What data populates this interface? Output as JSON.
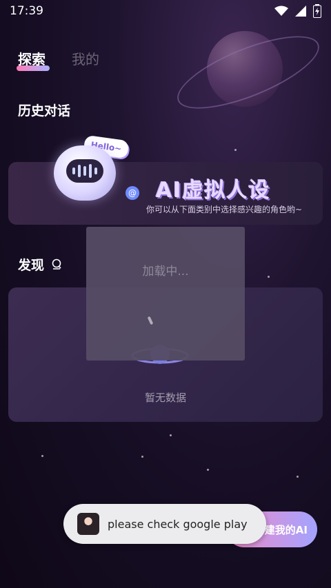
{
  "status_bar": {
    "time": "17:39"
  },
  "tabs": [
    {
      "label": "探索",
      "active": true
    },
    {
      "label": "我的",
      "active": false
    }
  ],
  "history_title": "历史对话",
  "banner": {
    "hello_text": "Hello~",
    "hash_symbol": "#",
    "at_symbol": "@",
    "title": "AI虚拟人设",
    "subtitle": "你可以从下面类别中选择感兴趣的角色哟~"
  },
  "discover": {
    "title": "发现",
    "empty_text": "暂无数据"
  },
  "loading": {
    "text": "加载中..."
  },
  "fab": {
    "label": "建我的AI"
  },
  "toast": {
    "text": "please check google play"
  },
  "colors": {
    "accent_pink": "#f089c7",
    "accent_blue": "#a3a3ff",
    "background": "#1f1430"
  }
}
